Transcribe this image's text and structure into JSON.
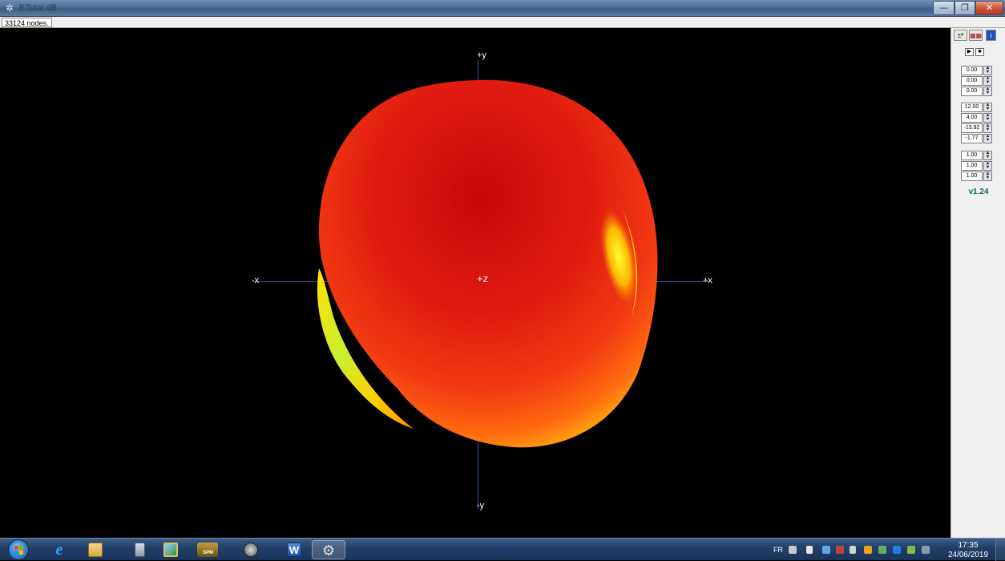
{
  "window": {
    "title": "ETotal dB",
    "icon": "gear-icon",
    "controls": {
      "minimize": "—",
      "maximize": "❐",
      "close": "✕"
    }
  },
  "status": {
    "nodes_text": "33124 nodes."
  },
  "viewport": {
    "axes": {
      "plus_y": "+y",
      "minus_y": "-y",
      "minus_x": "-x",
      "plus_x": "+x",
      "plus_z": "+z"
    },
    "colors": {
      "background": "#000000",
      "axis": "#3a4fc4",
      "surface_main": "#e8201a",
      "surface_hot": "#ffee00",
      "surface_edge": "#ff7a00"
    }
  },
  "panel": {
    "tools": [
      {
        "name": "plot-settings-icon",
        "label": "±⁰"
      },
      {
        "name": "grid-icon",
        "label": "▦▦"
      },
      {
        "name": "info-icon",
        "label": "i"
      }
    ],
    "playback": {
      "play": "▶",
      "stop": "■"
    },
    "rotation": [
      "0.00",
      "0.00",
      "0.00"
    ],
    "view": [
      "12.00",
      "4.00",
      "-13.92",
      "-1.77"
    ],
    "scale": [
      "1.00",
      "1.00",
      "1.00"
    ],
    "version": "v1.24"
  },
  "taskbar": {
    "pinned": [
      {
        "name": "internet-explorer-icon",
        "color": "#1f7ad8"
      },
      {
        "name": "file-explorer-icon",
        "color": "#e8c15a"
      },
      {
        "name": "calculator-icon",
        "color": "#9aa6b4"
      },
      {
        "name": "image-viewer-icon",
        "color": "#3b8f3b"
      },
      {
        "name": "spm-app-icon",
        "color": "#b48a2a",
        "label": "SPM"
      },
      {
        "name": "media-app-icon",
        "color": "#6b6b6b"
      },
      {
        "name": "word-icon",
        "color": "#2a5db0",
        "label": "W"
      },
      {
        "name": "settings-gear-icon",
        "color": "#d6d6d6"
      }
    ],
    "tray": {
      "language": "FR",
      "time": "17:35",
      "date": "24/06/2019"
    }
  }
}
